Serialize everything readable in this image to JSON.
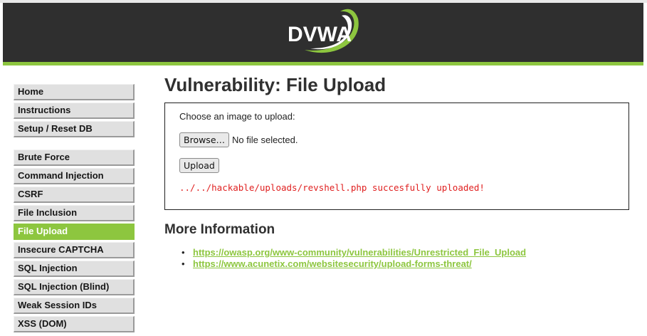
{
  "header": {
    "logo_text": "DVWA",
    "colors": {
      "header_bg": "#2f2f2f",
      "accent": "#8dc63f"
    }
  },
  "menu": {
    "group1": [
      "Home",
      "Instructions",
      "Setup / Reset DB"
    ],
    "group2": [
      "Brute Force",
      "Command Injection",
      "CSRF",
      "File Inclusion",
      "File Upload",
      "Insecure CAPTCHA",
      "SQL Injection",
      "SQL Injection (Blind)",
      "Weak Session IDs",
      "XSS (DOM)"
    ],
    "selected": "File Upload"
  },
  "main": {
    "title": "Vulnerability: File Upload",
    "form": {
      "prompt": "Choose an image to upload:",
      "browse_label": "Browse…",
      "file_status": "No file selected.",
      "upload_label": "Upload",
      "result_message": "../../hackable/uploads/revshell.php succesfully uploaded!",
      "result_color": "#e02020"
    },
    "more_info": {
      "heading": "More Information",
      "links": [
        "https://owasp.org/www-community/vulnerabilities/Unrestricted_File_Upload",
        "https://www.acunetix.com/websitesecurity/upload-forms-threat/"
      ]
    }
  }
}
